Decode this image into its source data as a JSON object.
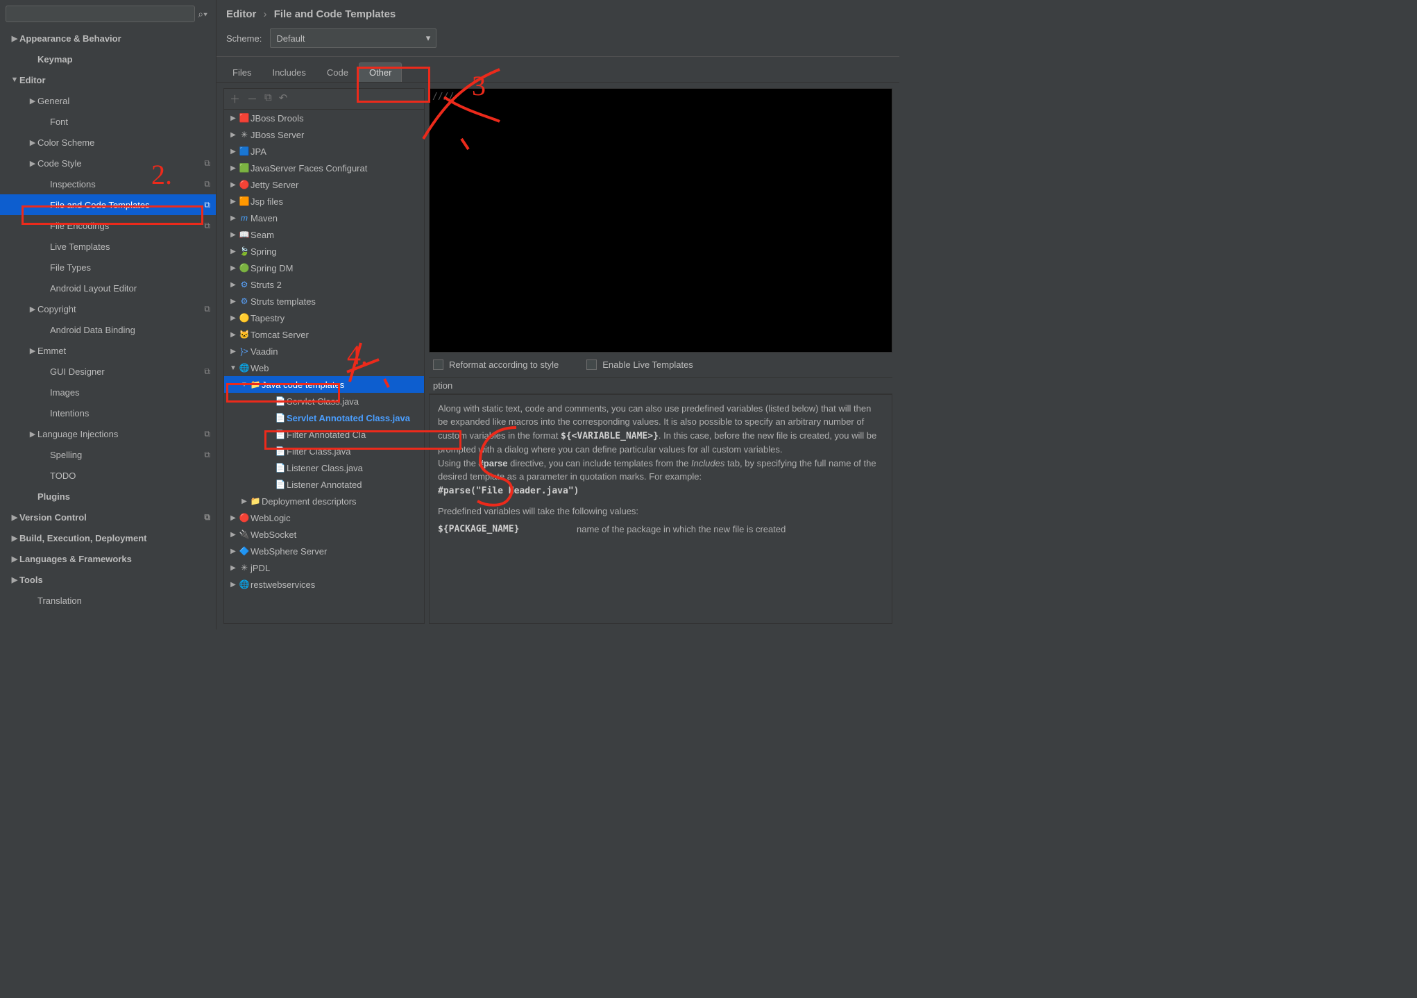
{
  "breadcrumb": {
    "segment1": "Editor",
    "segment2": "File and Code Templates"
  },
  "scheme": {
    "label": "Scheme:",
    "value": "Default"
  },
  "tabs": [
    "Files",
    "Includes",
    "Code",
    "Other"
  ],
  "sidebar": [
    {
      "lvl": 0,
      "arrow": "▶",
      "label": "Appearance & Behavior",
      "bold": true
    },
    {
      "lvl": 1,
      "arrow": "",
      "label": "Keymap",
      "bold": true
    },
    {
      "lvl": 0,
      "arrow": "▼",
      "label": "Editor",
      "bold": true
    },
    {
      "lvl": 1,
      "arrow": "▶",
      "label": "General"
    },
    {
      "lvl": 2,
      "arrow": "",
      "label": "Font"
    },
    {
      "lvl": 1,
      "arrow": "▶",
      "label": "Color Scheme"
    },
    {
      "lvl": 1,
      "arrow": "▶",
      "label": "Code Style",
      "badge": "⧉"
    },
    {
      "lvl": 2,
      "arrow": "",
      "label": "Inspections",
      "badge": "⧉"
    },
    {
      "lvl": 2,
      "arrow": "",
      "label": "File and Code Templates",
      "badge": "⧉",
      "selected": true
    },
    {
      "lvl": 2,
      "arrow": "",
      "label": "File Encodings",
      "badge": "⧉"
    },
    {
      "lvl": 2,
      "arrow": "",
      "label": "Live Templates"
    },
    {
      "lvl": 2,
      "arrow": "",
      "label": "File Types"
    },
    {
      "lvl": 2,
      "arrow": "",
      "label": "Android Layout Editor"
    },
    {
      "lvl": 1,
      "arrow": "▶",
      "label": "Copyright",
      "badge": "⧉"
    },
    {
      "lvl": 2,
      "arrow": "",
      "label": "Android Data Binding"
    },
    {
      "lvl": 1,
      "arrow": "▶",
      "label": "Emmet"
    },
    {
      "lvl": 2,
      "arrow": "",
      "label": "GUI Designer",
      "badge": "⧉"
    },
    {
      "lvl": 2,
      "arrow": "",
      "label": "Images"
    },
    {
      "lvl": 2,
      "arrow": "",
      "label": "Intentions"
    },
    {
      "lvl": 1,
      "arrow": "▶",
      "label": "Language Injections",
      "badge": "⧉"
    },
    {
      "lvl": 2,
      "arrow": "",
      "label": "Spelling",
      "badge": "⧉"
    },
    {
      "lvl": 2,
      "arrow": "",
      "label": "TODO"
    },
    {
      "lvl": 1,
      "arrow": "",
      "label": "Plugins",
      "bold": true
    },
    {
      "lvl": 0,
      "arrow": "▶",
      "label": "Version Control",
      "bold": true,
      "badge": "⧉"
    },
    {
      "lvl": 0,
      "arrow": "▶",
      "label": "Build, Execution, Deployment",
      "bold": true
    },
    {
      "lvl": 0,
      "arrow": "▶",
      "label": "Languages & Frameworks",
      "bold": true
    },
    {
      "lvl": 0,
      "arrow": "▶",
      "label": "Tools",
      "bold": true
    },
    {
      "lvl": 1,
      "arrow": "",
      "label": "Translation"
    }
  ],
  "templates": [
    {
      "lvl": 1,
      "arrow": "▶",
      "icon": "🟥",
      "label": "JBoss Drools"
    },
    {
      "lvl": 1,
      "arrow": "▶",
      "icon": "✳",
      "label": "JBoss Server"
    },
    {
      "lvl": 1,
      "arrow": "▶",
      "icon": "🟦",
      "label": "JPA"
    },
    {
      "lvl": 1,
      "arrow": "▶",
      "icon": "🟩",
      "label": "JavaServer Faces Configurat"
    },
    {
      "lvl": 1,
      "arrow": "▶",
      "icon": "🔴",
      "label": "Jetty Server"
    },
    {
      "lvl": 1,
      "arrow": "▶",
      "icon": "🟧",
      "label": "Jsp files"
    },
    {
      "lvl": 1,
      "arrow": "▶",
      "icon": "m",
      "label": "Maven",
      "iconColor": "#4aa3ff",
      "iconItalic": true
    },
    {
      "lvl": 1,
      "arrow": "▶",
      "icon": "📖",
      "label": "Seam"
    },
    {
      "lvl": 1,
      "arrow": "▶",
      "icon": "🍃",
      "label": "Spring"
    },
    {
      "lvl": 1,
      "arrow": "▶",
      "icon": "🟢",
      "label": "Spring DM"
    },
    {
      "lvl": 1,
      "arrow": "▶",
      "icon": "⚙",
      "label": "Struts 2",
      "iconColor": "#5aa4ff"
    },
    {
      "lvl": 1,
      "arrow": "▶",
      "icon": "⚙",
      "label": "Struts templates",
      "iconColor": "#5aa4ff"
    },
    {
      "lvl": 1,
      "arrow": "▶",
      "icon": "🟡",
      "label": "Tapestry"
    },
    {
      "lvl": 1,
      "arrow": "▶",
      "icon": "🐱",
      "label": "Tomcat Server",
      "iconColor": "#e0b84a"
    },
    {
      "lvl": 1,
      "arrow": "▶",
      "icon": "}>",
      "label": "Vaadin",
      "iconColor": "#5aa4ff"
    },
    {
      "lvl": 1,
      "arrow": "▼",
      "icon": "🌐",
      "label": "Web"
    },
    {
      "lvl": 2,
      "arrow": "▼",
      "icon": "📁",
      "label": "Java code templates",
      "selGrp": true
    },
    {
      "lvl": 3,
      "arrow": "",
      "icon": "📄",
      "label": "Servlet Class.java"
    },
    {
      "lvl": 3,
      "arrow": "",
      "icon": "📄",
      "label": "Servlet Annotated Class.java",
      "selItem": true
    },
    {
      "lvl": 3,
      "arrow": "",
      "icon": "📄",
      "label": "Filter Annotated Cla"
    },
    {
      "lvl": 3,
      "arrow": "",
      "icon": "📄",
      "label": "Filter Class.java"
    },
    {
      "lvl": 3,
      "arrow": "",
      "icon": "📄",
      "label": "Listener Class.java"
    },
    {
      "lvl": 3,
      "arrow": "",
      "icon": "📄",
      "label": "Listener Annotated"
    },
    {
      "lvl": 2,
      "arrow": "▶",
      "icon": "📁",
      "label": "Deployment descriptors"
    },
    {
      "lvl": 1,
      "arrow": "▶",
      "icon": "🔴",
      "label": "WebLogic"
    },
    {
      "lvl": 1,
      "arrow": "▶",
      "icon": "🔌",
      "label": "WebSocket"
    },
    {
      "lvl": 1,
      "arrow": "▶",
      "icon": "🔷",
      "label": "WebSphere Server"
    },
    {
      "lvl": 1,
      "arrow": "▶",
      "icon": "✳",
      "label": "jPDL"
    },
    {
      "lvl": 1,
      "arrow": "▶",
      "icon": "🌐",
      "label": "restwebservices"
    }
  ],
  "checkboxes": {
    "reformat": "Reformat according to style",
    "liveTemplates": "Enable Live Templates"
  },
  "descriptionHeader": "ption",
  "description": {
    "p1a": "Along with static text, code and comments, you can also use predefined variables (listed below) that will then be expanded like macros into the corresponding values. It is also possible to specify an arbitrary number of custom variables in the format ",
    "p1var": "${<VARIABLE_NAME>}",
    "p1b": ". In this case, before the new file is created, you will be prompted with a dialog where you can define particular values for all custom variables.",
    "p2a": "Using the ",
    "p2dir": "#parse",
    "p2b": " directive, you can include templates from the ",
    "p2tab": "Includes",
    "p2c": " tab, by specifying the full name of the desired template as a parameter in quotation marks. For example:",
    "p3": "#parse(\"File Header.java\")",
    "p4": "Predefined variables will take the following values:",
    "var1name": "${PACKAGE_NAME}",
    "var1desc": "name of the package in which the new file is created"
  },
  "annotations": {
    "n2": "2.",
    "n3": "3",
    "n4": "4.",
    "n5": "5"
  }
}
